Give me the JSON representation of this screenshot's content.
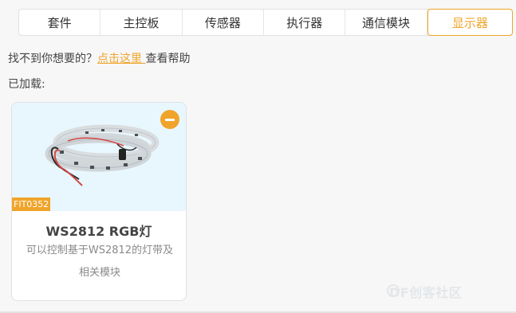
{
  "tabs": [
    {
      "label": "套件",
      "active": false
    },
    {
      "label": "主控板",
      "active": false
    },
    {
      "label": "传感器",
      "active": false
    },
    {
      "label": "执行器",
      "active": false
    },
    {
      "label": "通信模块",
      "active": false
    },
    {
      "label": "显示器",
      "active": true
    }
  ],
  "help": {
    "prefix": "找不到你想要的？",
    "link": "点击这里 ",
    "suffix": "查看帮助"
  },
  "loaded_label": "已加载:",
  "card": {
    "sku": "FIT0352",
    "title": "WS2812 RGB灯",
    "description": "可以控制基于WS2812的灯带及相关模块",
    "image_icon": "led-strip-image"
  },
  "watermark": "DF创客社区",
  "colors": {
    "accent": "#f0a42a",
    "card_image_bg": "#e8f7fd"
  }
}
